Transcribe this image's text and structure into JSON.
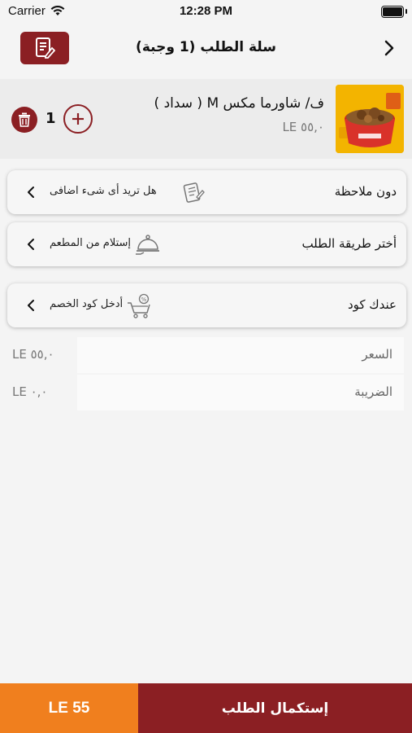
{
  "status_bar": {
    "carrier": "Carrier",
    "time": "12:28 PM"
  },
  "header": {
    "title": "سلة الطلب (1 وجبة)"
  },
  "cart_item": {
    "name": "ف/ شاورما مكس M ( سداد )",
    "price": "LE ٥٥,٠",
    "quantity": "1"
  },
  "options": {
    "note": {
      "label": "دون ملاحظة",
      "prompt": "هل تريد أى شىء اضافى"
    },
    "order_method": {
      "label": "أختر طريقة الطلب",
      "value": "إستلام من المطعم"
    },
    "discount": {
      "label": "عندك كود",
      "prompt": "أدخل كود الخصم"
    }
  },
  "summary": {
    "price_label": "السعر",
    "price_value": "LE  ٥٥,٠",
    "tax_label": "الضريبة",
    "tax_value": "LE  ٠,٠"
  },
  "footer": {
    "total": "LE 55",
    "checkout_label": "إستكمال الطلب"
  },
  "colors": {
    "primary": "#8b1f23",
    "accent": "#f07f1e"
  }
}
